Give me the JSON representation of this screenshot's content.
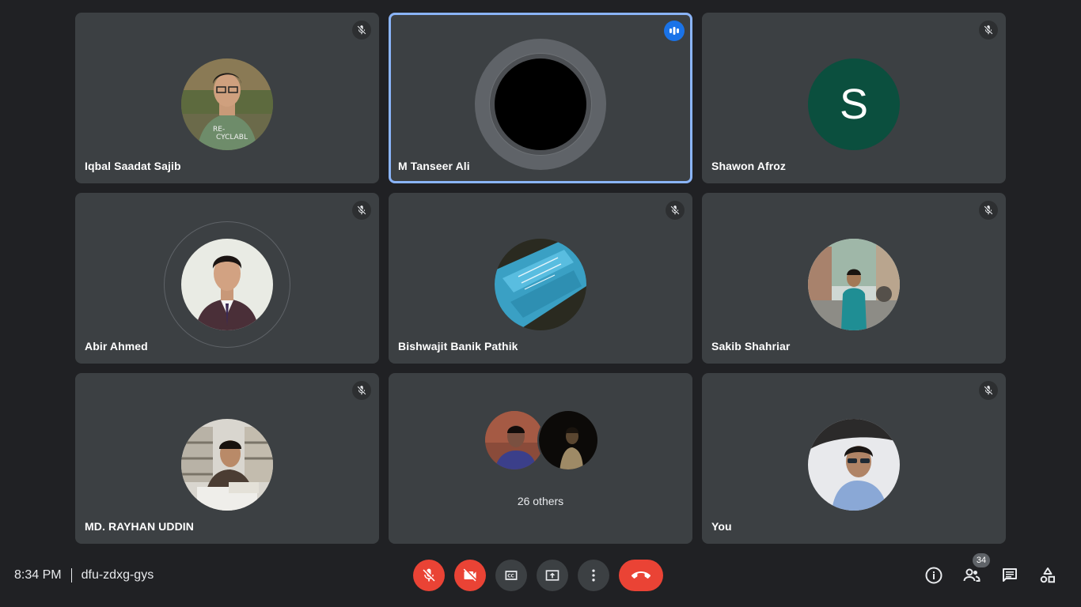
{
  "participants": [
    {
      "name": "Iqbal Saadat Sajib",
      "muted": true
    },
    {
      "name": "M Tanseer Ali",
      "speaking": true
    },
    {
      "name": "Shawon Afroz",
      "muted": true,
      "initial": "S"
    },
    {
      "name": "Abir Ahmed",
      "muted": true
    },
    {
      "name": "Bishwajit Banik Pathik",
      "muted": true
    },
    {
      "name": "Sakib Shahriar",
      "muted": true
    },
    {
      "name": "MD. RAYHAN UDDIN",
      "muted": true
    },
    {
      "name": "26 others"
    },
    {
      "name": "You",
      "muted": true
    }
  ],
  "bottom_bar": {
    "time": "8:34 PM",
    "meeting_code": "dfu-zdxg-gys",
    "participant_count": "34"
  },
  "colors": {
    "background": "#202124",
    "tile": "#3c4043",
    "accent_red": "#ea4335",
    "speaking_blue": "#8ab4f8",
    "shawon_avatar": "#0b4f3e"
  },
  "icons": {
    "mute": "mic-off-icon",
    "speaking": "audio-level-icon",
    "camera_off": "videocam-off-icon",
    "captions": "closed-caption-icon",
    "present": "present-screen-icon",
    "more": "more-vert-icon",
    "hangup": "call-end-icon",
    "info": "info-icon",
    "people": "people-icon",
    "chat": "chat-icon",
    "activities": "activities-icon"
  }
}
